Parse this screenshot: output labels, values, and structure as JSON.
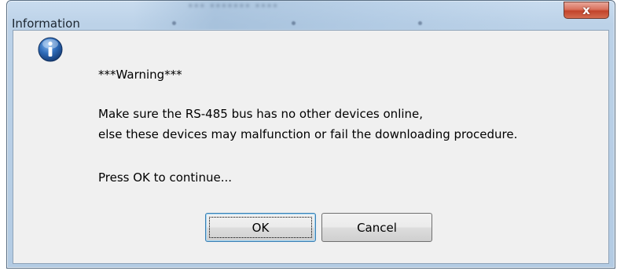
{
  "window": {
    "title": "Information",
    "close_glyph": "x",
    "background_ghost_title": "*** *******  ****"
  },
  "dialog": {
    "icon": "information-icon",
    "heading": "***Warning***",
    "line1": "Make sure the RS-485 bus has no other devices online,",
    "line2": "else these devices may malfunction or fail the downloading procedure.",
    "prompt": "Press OK to continue..."
  },
  "buttons": {
    "ok_label": "OK",
    "cancel_label": "Cancel"
  },
  "colors": {
    "close_button": "#c2432b",
    "client_background": "#f0f0f0",
    "frame": "#bcd2e8",
    "info_icon": "#2e6bb8"
  }
}
